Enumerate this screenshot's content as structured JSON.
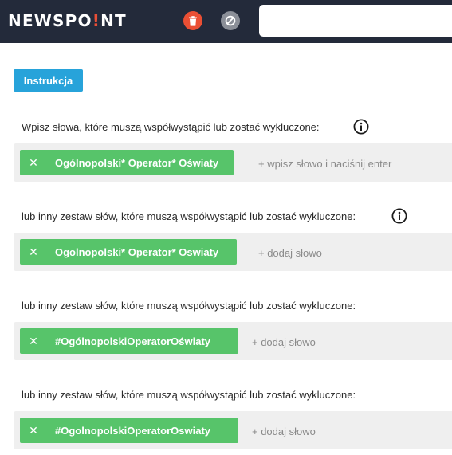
{
  "header": {
    "logo_before": "NEWSPO",
    "logo_accent": "!",
    "logo_after": "NT",
    "search": {
      "value": "",
      "placeholder": ""
    },
    "icons": {
      "delete": "trash-icon",
      "block": "block-icon"
    },
    "colors": {
      "background": "#232a3a",
      "delete": "#ea4f34",
      "block": "#8b8f98",
      "accent": "#e94e36"
    }
  },
  "instructions_button": {
    "label": "Instrukcja",
    "color": "#27a3da"
  },
  "sections": [
    {
      "label": "Wpisz słowa, które muszą współwystąpić lub zostać wykluczone:",
      "has_info": true,
      "tag": "Ogólnopolski* Operator* Oświaty",
      "input_placeholder": "+ wpisz słowo i naciśnij enter"
    },
    {
      "label": "lub inny zestaw słów, które muszą współwystąpić lub zostać wykluczone:",
      "has_info": true,
      "tag": "Ogolnopolski* Operator* Oswiaty",
      "input_placeholder": "+ dodaj słowo"
    },
    {
      "label": "lub inny zestaw słów, które muszą współwystąpić lub zostać wykluczone:",
      "has_info": false,
      "tag": "#OgólnopolskiOperatorOświaty",
      "input_placeholder": "+ dodaj słowo"
    },
    {
      "label": "lub inny zestaw słów, które muszą współwystąpić lub zostać wykluczone:",
      "has_info": false,
      "tag": "#OgolnopolskiOperatorOswiaty",
      "input_placeholder": "+ dodaj słowo"
    }
  ],
  "tag_remove_glyph": "✕",
  "tag_color": "#57c46a"
}
